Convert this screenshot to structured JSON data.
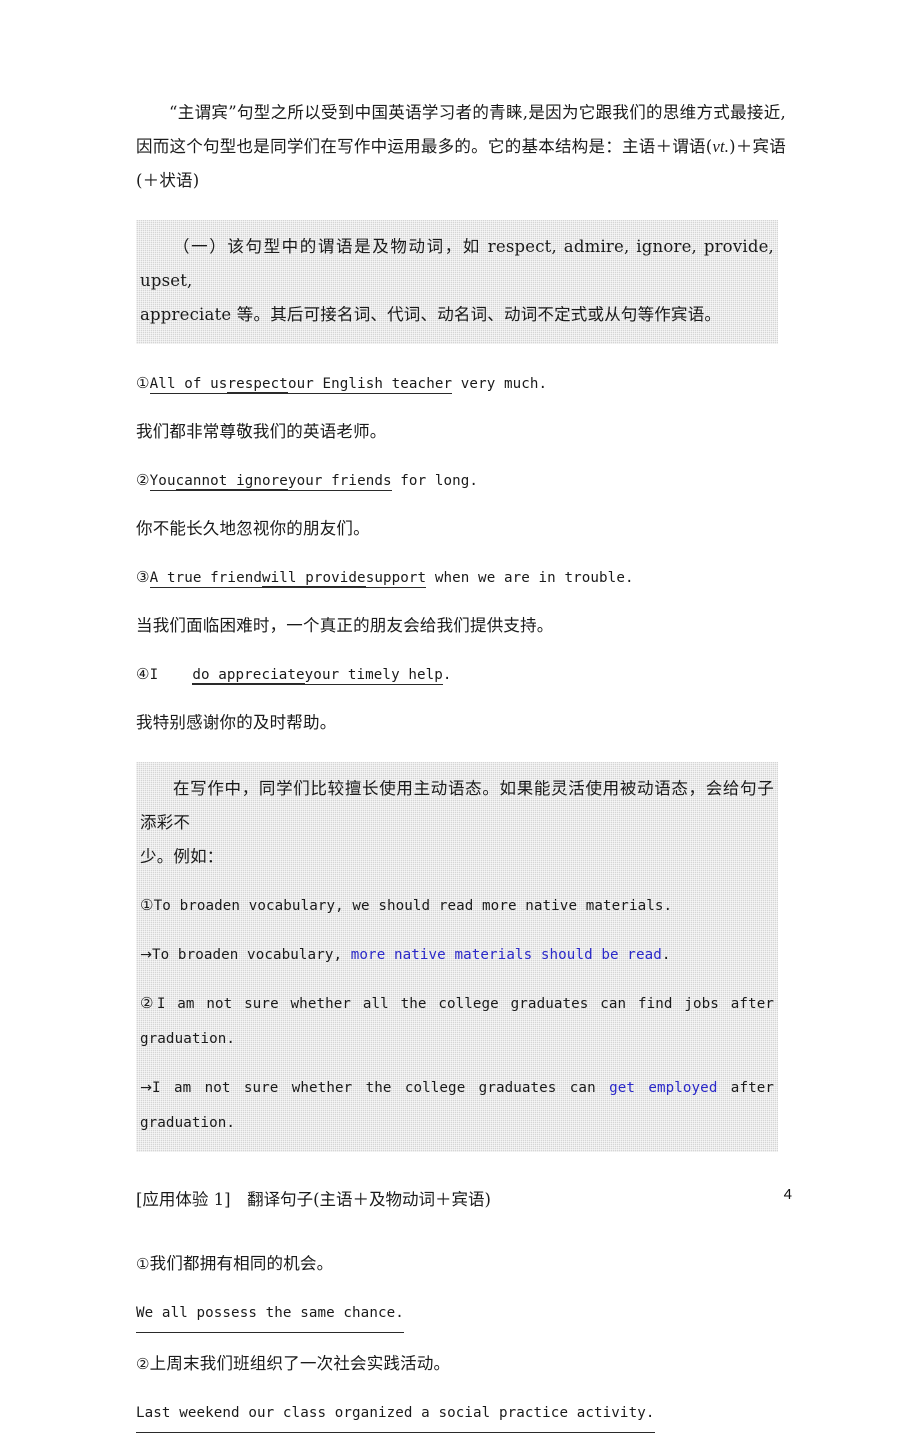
{
  "page": {
    "number": "4",
    "accent_blue": "#2a28c8",
    "shade_color": "#d5d5d5"
  },
  "intro": {
    "text": "“主谓宾”句型之所以受到中国英语学习者的青睐,是因为它跟我们的思维方式最接近,因而这个句型也是同学们在写作中运用最多的。它的基本结构是：主语＋谓语(",
    "italic_note": "vt.",
    "text_tail": ")＋宾语(＋状语)"
  },
  "box1": {
    "line1": "（一）该句型中的谓语是及物动词，如 respect, admire, ignore, provide, upset,",
    "line2": "appreciate 等。其后可接名词、代词、动名词、动词不定式或从句等作宾语。"
  },
  "examples": [
    {
      "marker": "①",
      "subject": "All of us",
      "verb": "respect",
      "object": "our English teacher",
      "tail": " very much.",
      "translation": "我们都非常尊敬我们的英语老师。"
    },
    {
      "marker": "②",
      "subject": "You",
      "verb": "cannot ignore",
      "object": "your friends",
      "tail": " for long.",
      "translation": "你不能长久地忽视你的朋友们。"
    },
    {
      "marker": "③",
      "subject": "A true friend",
      "verb": "will provide",
      "object": "support",
      "tail": " when we are in trouble.",
      "translation": "当我们面临困难时，一个真正的朋友会给我们提供支持。"
    },
    {
      "marker": "④",
      "subject": "I",
      "verb": "do appreciate",
      "object": "your timely help",
      "tail": ".",
      "translation": "我特别感谢你的及时帮助。"
    }
  ],
  "box2": {
    "intro_line1": "在写作中，同学们比较擅长使用主动语态。如果能灵活使用被动语态，会给句子添彩不",
    "intro_line2": "少。例如：",
    "items": [
      {
        "marker": "①",
        "source": "To broaden vocabulary, we should read more native materials.",
        "arrow": "→",
        "rewrite_plain_head": "To broaden vocabulary, ",
        "rewrite_highlight": "more native materials should be read",
        "rewrite_plain_tail": "."
      },
      {
        "marker": "②",
        "source": "I am not sure whether all the college graduates can find jobs after graduation.",
        "arrow": "→",
        "rewrite_plain_head": "I am not sure whether the college graduates can ",
        "rewrite_highlight": "get employed",
        "rewrite_plain_tail": " after graduation."
      }
    ]
  },
  "exercise": {
    "heading": "[应用体验 1]　翻译句子(主语＋及物动词＋宾语)",
    "items": [
      {
        "marker": "①",
        "prompt": "我们都拥有相同的机会。",
        "answer": "We all possess the same chance."
      },
      {
        "marker": "②",
        "prompt": "上周末我们班组织了一次社会实践活动。",
        "answer": "Last weekend our class organized a social practice activity."
      }
    ]
  }
}
